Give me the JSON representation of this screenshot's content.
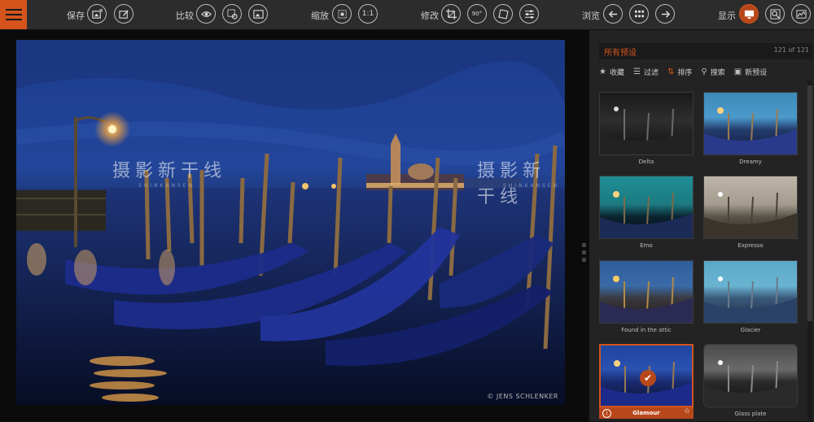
{
  "toolbar": {
    "save_label": "保存",
    "compare_label": "比较",
    "zoom_label": "缩放",
    "zoom_level": "1:1",
    "edit_label": "修改",
    "rotate_label": "90°",
    "browse_label": "浏览",
    "display_label": "显示"
  },
  "image": {
    "watermark_text": "摄影新干线",
    "watermark_sub": "SHINKANSEN",
    "copyright": "© JENS SCHLENKER"
  },
  "panel": {
    "title": "所有预设",
    "count": "121 of 121",
    "filters": {
      "favorites": "收藏",
      "filter": "过滤",
      "sort": "排序",
      "search": "搜索",
      "new_preset": "新预设"
    },
    "presets": [
      {
        "name": "Delta"
      },
      {
        "name": "Dreamy"
      },
      {
        "name": "Emo"
      },
      {
        "name": "Expresso"
      },
      {
        "name": "Found in the attic"
      },
      {
        "name": "Glacier"
      },
      {
        "name": "Glamour"
      },
      {
        "name": "Glass plate"
      }
    ]
  },
  "colors": {
    "accent": "#d4541c",
    "toolbar_bg": "#2c2c2c",
    "panel_bg": "#232323"
  }
}
